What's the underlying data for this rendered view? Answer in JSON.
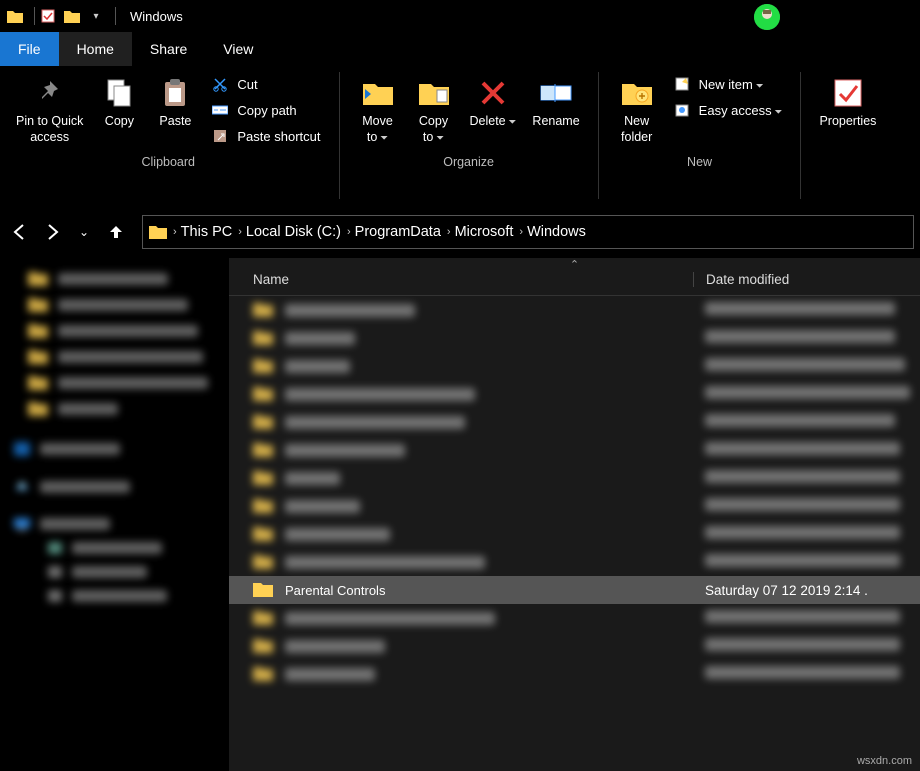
{
  "window": {
    "title": "Windows"
  },
  "tabs": {
    "file": "File",
    "home": "Home",
    "share": "Share",
    "view": "View"
  },
  "ribbon": {
    "pin": "Pin to Quick\naccess",
    "copy": "Copy",
    "paste": "Paste",
    "cut": "Cut",
    "copy_path": "Copy path",
    "paste_shortcut": "Paste shortcut",
    "group_clipboard": "Clipboard",
    "move_to": "Move\nto",
    "copy_to": "Copy\nto",
    "delete": "Delete",
    "rename": "Rename",
    "group_organize": "Organize",
    "new_folder": "New\nfolder",
    "new_item": "New item",
    "easy_access": "Easy access",
    "group_new": "New",
    "properties": "Properties"
  },
  "breadcrumb": [
    "This PC",
    "Local Disk (C:)",
    "ProgramData",
    "Microsoft",
    "Windows"
  ],
  "columns": {
    "name": "Name",
    "date": "Date modified"
  },
  "selected_row": {
    "name": "Parental Controls",
    "date": "Saturday 07 12 2019 2:14 ."
  },
  "watermark": "wsxdn.com"
}
